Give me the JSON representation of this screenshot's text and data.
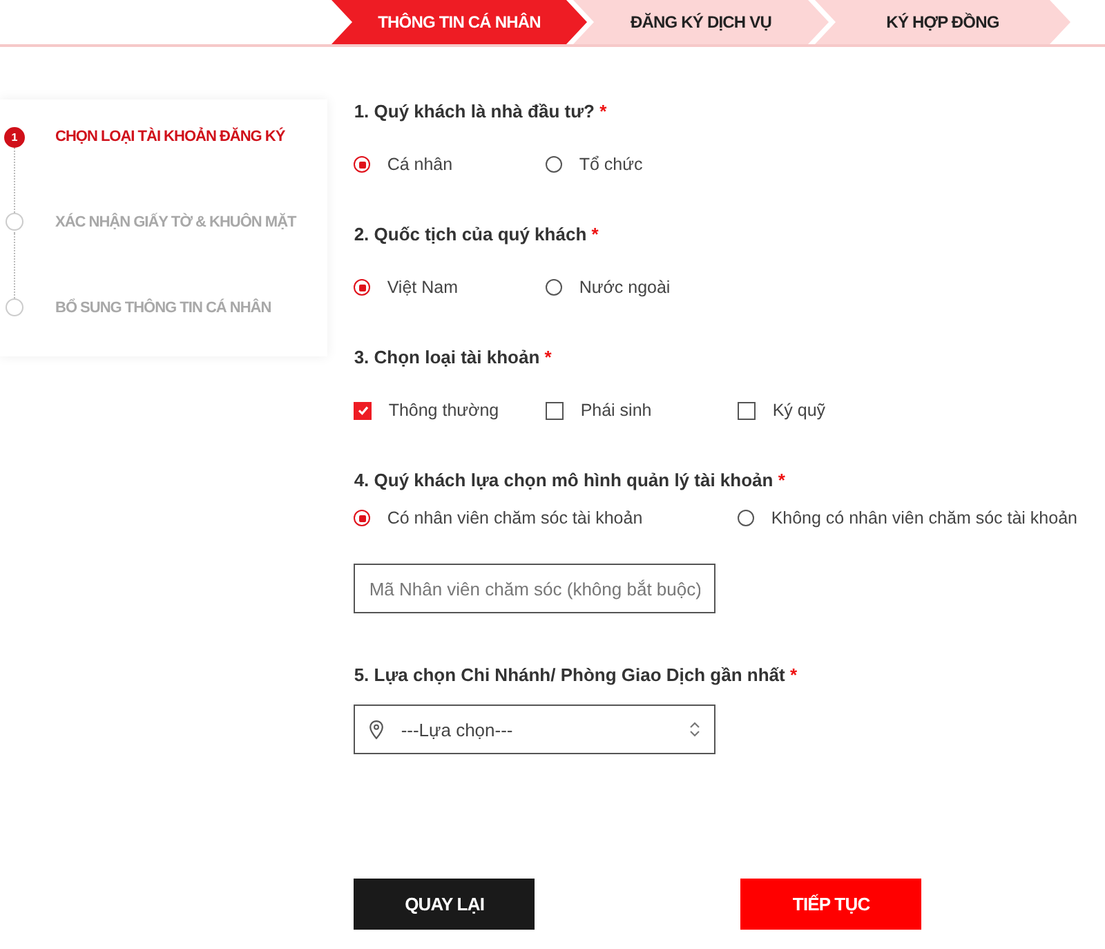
{
  "steps": [
    {
      "label": "THÔNG TIN CÁ NHÂN",
      "selected": true
    },
    {
      "label": "ĐĂNG KÝ DỊCH VỤ",
      "selected": false
    },
    {
      "label": "KÝ HỢP ĐỒNG",
      "selected": false
    }
  ],
  "sidebar": {
    "items": [
      {
        "label": "CHỌN LOẠI TÀI KHOẢN ĐĂNG KÝ",
        "number": "1",
        "selected": true
      },
      {
        "label": "XÁC NHẬN GIẤY TỜ & KHUÔN MẶT",
        "selected": false
      },
      {
        "label": "BỔ SUNG THÔNG TIN CÁ NHÂN",
        "selected": false
      }
    ]
  },
  "questions": [
    {
      "label": "1. Quý khách là nhà đầu tư?",
      "required": "*",
      "kind": "radio",
      "options": [
        {
          "label": "Cá nhân",
          "selected": true
        },
        {
          "label": "Tổ chức",
          "selected": false
        }
      ]
    },
    {
      "label": "2. Quốc tịch của quý khách",
      "required": "*",
      "kind": "radio",
      "options": [
        {
          "label": "Việt Nam",
          "selected": true
        },
        {
          "label": "Nước ngoài",
          "selected": false
        }
      ]
    },
    {
      "label": "3. Chọn loại tài khoản",
      "required": "*",
      "kind": "checkbox",
      "options": [
        {
          "label": "Thông thường",
          "checked": true
        },
        {
          "label": "Phái sinh",
          "checked": false
        },
        {
          "label": "Ký quỹ",
          "checked": false
        }
      ]
    },
    {
      "label": "4. Quý khách lựa chọn mô hình quản lý tài khoản",
      "required": "*",
      "kind": "radio",
      "options": [
        {
          "label": "Có nhân viên chăm sóc tài khoản",
          "selected": true
        },
        {
          "label": "Không có nhân viên chăm sóc tài khoản",
          "selected": false
        }
      ],
      "input": {
        "placeholder": "Mã Nhân viên chăm sóc (không bắt buộc)"
      }
    },
    {
      "label": "5. Lựa chọn Chi Nhánh/ Phòng Giao Dịch gần nhất",
      "required": "*",
      "kind": "select",
      "value": "---Lựa chọn---"
    }
  ],
  "buttons": [
    {
      "label": "QUAY LẠI",
      "kind": "back"
    },
    {
      "label": "TIẾP TỤC",
      "kind": "next"
    }
  ]
}
